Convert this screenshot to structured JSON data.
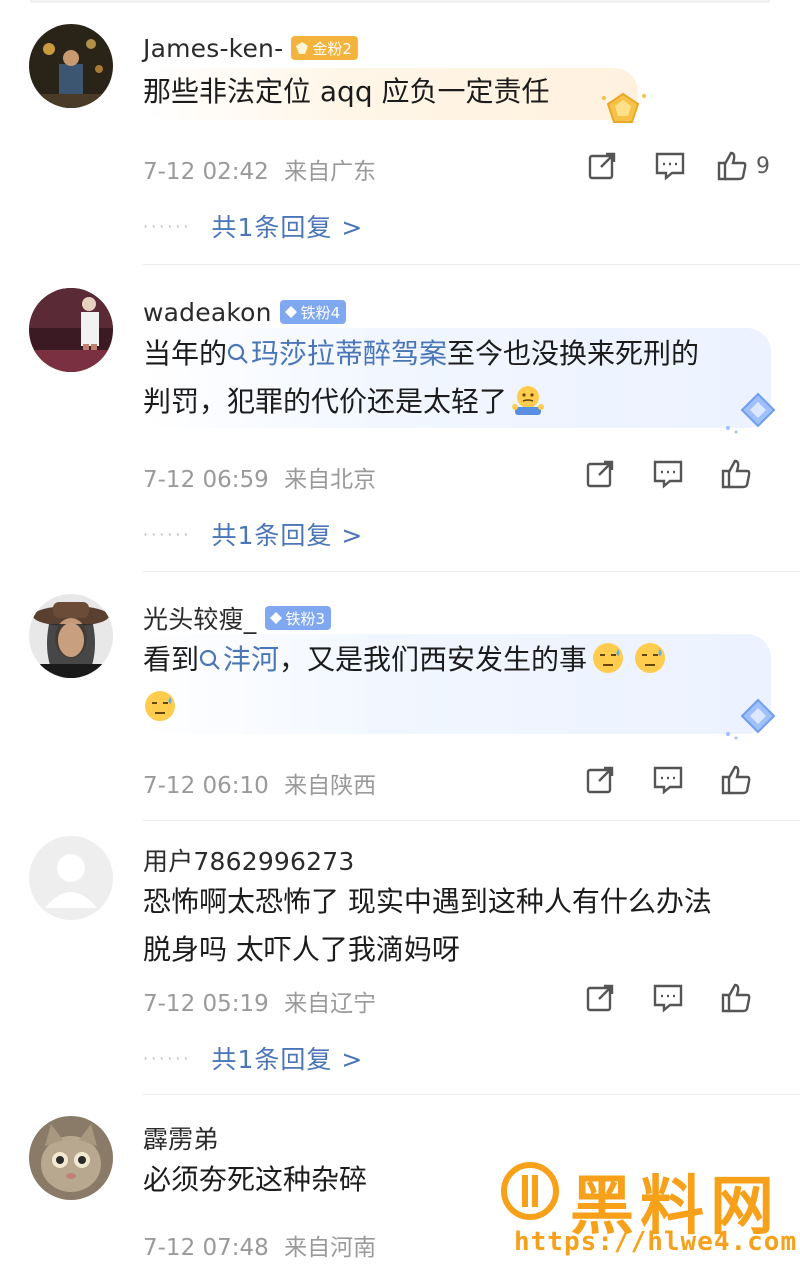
{
  "comments": [
    {
      "username": "James-ken-",
      "badge": "金粉2",
      "badge_type": "gold",
      "text_lines": [
        "那些非法定位 aqq 应负一定责任"
      ],
      "time": "7-12 02:42",
      "location": "来自广东",
      "likes": "9",
      "reply_text": "共1条回复 >"
    },
    {
      "username": "wadeakon",
      "badge": "铁粉4",
      "badge_type": "iron",
      "prefix": "当年的",
      "topic": "玛莎拉蒂醉驾案",
      "suffix": "至今也没换来死刑的",
      "line2": "判罚，犯罪的代价还是太轻了",
      "time": "7-12 06:59",
      "location": "来自北京",
      "reply_text": "共1条回复 >"
    },
    {
      "username": "光头较瘦_",
      "badge": "铁粉3",
      "badge_type": "iron",
      "prefix": "看到",
      "topic": "沣河",
      "suffix": "，又是我们西安发生的事",
      "time": "7-12 06:10",
      "location": "来自陕西"
    },
    {
      "username": "用户7862996273",
      "text_lines": [
        "恐怖啊太恐怖了 现实中遇到这种人有什么办法",
        "脱身吗 太吓人了我滴妈呀"
      ],
      "time": "7-12 05:19",
      "location": "来自辽宁",
      "reply_text": "共1条回复 >"
    },
    {
      "username": "霹雳弟",
      "text_lines": [
        "必须夯死这种杂碎"
      ],
      "time": "7-12 07:48",
      "location": "来自河南"
    }
  ],
  "watermark": {
    "title": "黑料网",
    "url": "https://hlwe4.com"
  },
  "icons": {
    "share": "share-icon",
    "comment": "comment-icon",
    "like": "like-icon",
    "search": "search-icon"
  },
  "colors": {
    "link": "#4a76b8",
    "gold_badge": "#f3b33d",
    "iron_badge": "#7fa8f0",
    "watermark": "#f7a01a"
  }
}
